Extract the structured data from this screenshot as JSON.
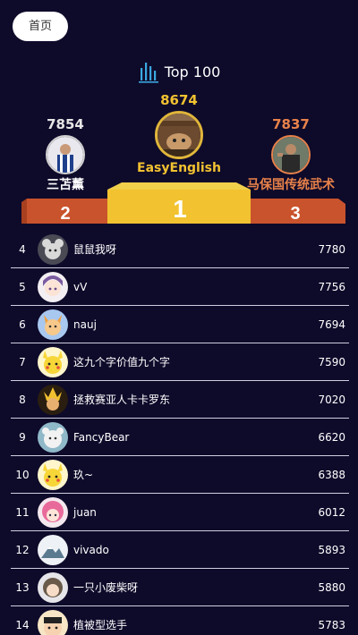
{
  "header": {
    "home_label": "首页",
    "title": "Top 100"
  },
  "podium": {
    "first": {
      "score": "8674",
      "name": "EasyEnglish",
      "place": "1"
    },
    "second": {
      "score": "7854",
      "name": "三苫薰",
      "place": "2"
    },
    "third": {
      "score": "7837",
      "name": "马保国传统武术",
      "place": "3"
    }
  },
  "colors": {
    "background": "#0e0a2a",
    "gold": "#f2c230",
    "bronze": "#e8824a",
    "podium_red": "#c9532c"
  },
  "rows": [
    {
      "rank": "4",
      "name": "鼠鼠我呀",
      "score": "7780",
      "avatar": "mouse-avatar"
    },
    {
      "rank": "5",
      "name": "vV",
      "score": "7756",
      "avatar": "anime-girl-avatar"
    },
    {
      "rank": "6",
      "name": "nauj",
      "score": "7694",
      "avatar": "fox-avatar"
    },
    {
      "rank": "7",
      "name": "这九个字价值九个字",
      "score": "7590",
      "avatar": "pikachu-avatar"
    },
    {
      "rank": "8",
      "name": "拯救赛亚人卡卡罗东",
      "score": "7020",
      "avatar": "saiyan-avatar"
    },
    {
      "rank": "9",
      "name": "FancyBear",
      "score": "6620",
      "avatar": "bear-avatar"
    },
    {
      "rank": "10",
      "name": "玖~",
      "score": "6388",
      "avatar": "pikachu-avatar"
    },
    {
      "rank": "11",
      "name": "juan",
      "score": "6012",
      "avatar": "pink-hair-avatar"
    },
    {
      "rank": "12",
      "name": "vivado",
      "score": "5893",
      "avatar": "mountain-avatar"
    },
    {
      "rank": "13",
      "name": "一只小废柴呀",
      "score": "5880",
      "avatar": "girl-avatar"
    },
    {
      "rank": "14",
      "name": "植被型选手",
      "score": "5783",
      "avatar": "cartoon-boy-avatar"
    }
  ]
}
